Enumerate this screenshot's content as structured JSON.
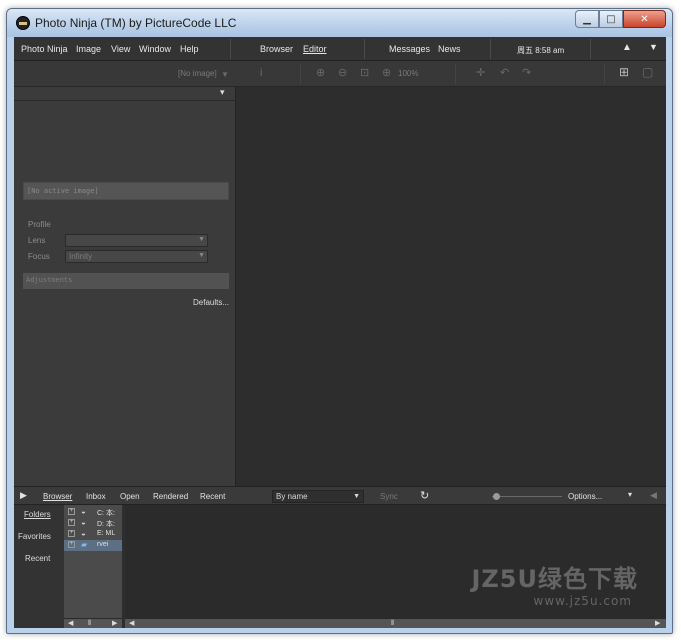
{
  "window": {
    "title": "Photo Ninja (TM) by PictureCode LLC"
  },
  "menubar": {
    "items": [
      "Photo Ninja",
      "Image",
      "View",
      "Window",
      "Help"
    ],
    "browser": "Browser",
    "editor": "Editor",
    "messages": "Messages",
    "news": "News",
    "clock": "周五 8:58 am"
  },
  "toolbar": {
    "image_select": "[No image]",
    "zoom_level": "100%"
  },
  "left_panel": {
    "active_image": "[No active image]",
    "profile_label": "Profile",
    "lens_label": "Lens",
    "lens_value": "",
    "focus_label": "Focus",
    "focus_value": "Infinity",
    "adjustments_label": "Adjustments",
    "defaults_button": "Defaults..."
  },
  "bottom_bar": {
    "tabs": [
      "Browser",
      "Inbox",
      "Open",
      "Rendered",
      "Recent"
    ],
    "sort_value": "By name",
    "sync": "Sync",
    "options": "Options..."
  },
  "nav": {
    "folders": "Folders",
    "favorites": "Favorites",
    "recent": "Recent"
  },
  "tree": [
    {
      "label": "C: 本:",
      "expand": "+"
    },
    {
      "label": "D: 本:",
      "expand": "+"
    },
    {
      "label": "E: ML",
      "expand": "+"
    },
    {
      "label": "rvei",
      "expand": "+",
      "selected": true
    }
  ],
  "watermark": {
    "line1": "JZ5U绿色下载",
    "line2": "www.jz5u.com"
  }
}
